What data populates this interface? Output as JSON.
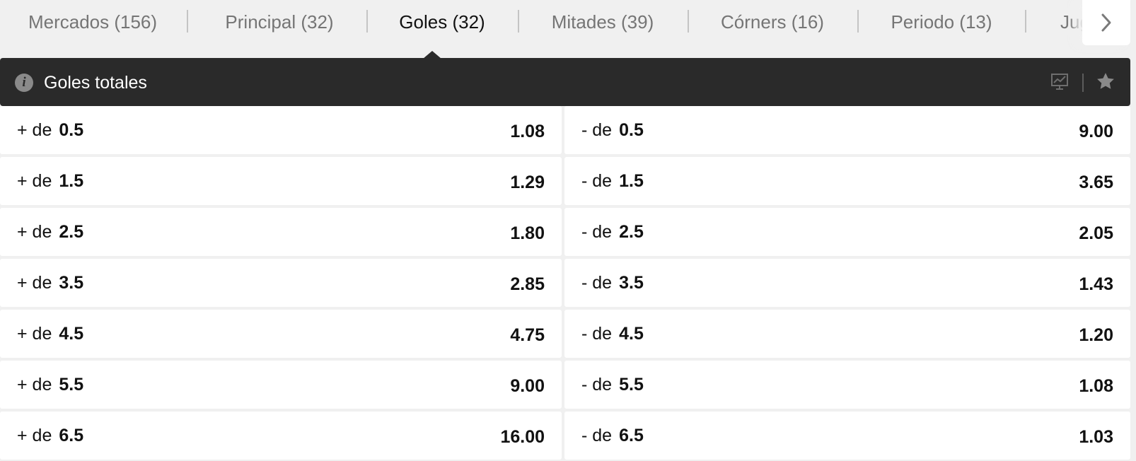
{
  "tabs": [
    {
      "label": "Mercados (156)",
      "active": false
    },
    {
      "label": "Principal (32)",
      "active": false
    },
    {
      "label": "Goles (32)",
      "active": true
    },
    {
      "label": "Mitades (39)",
      "active": false
    },
    {
      "label": "Córners (16)",
      "active": false
    },
    {
      "label": "Periodo (13)",
      "active": false
    },
    {
      "label": "Jug",
      "active": false
    }
  ],
  "tabs_next_icon": "chevron-right-icon",
  "market": {
    "title": "Goles totales",
    "info_icon": "info-icon",
    "info_glyph": "i",
    "stats_icon": "stats-chart-icon",
    "favorite_icon": "star-icon"
  },
  "rows": [
    {
      "over": {
        "prefix": "+ de",
        "line": "0.5",
        "odds": "1.08"
      },
      "under": {
        "prefix": "- de",
        "line": "0.5",
        "odds": "9.00"
      }
    },
    {
      "over": {
        "prefix": "+ de",
        "line": "1.5",
        "odds": "1.29"
      },
      "under": {
        "prefix": "- de",
        "line": "1.5",
        "odds": "3.65"
      }
    },
    {
      "over": {
        "prefix": "+ de",
        "line": "2.5",
        "odds": "1.80"
      },
      "under": {
        "prefix": "- de",
        "line": "2.5",
        "odds": "2.05"
      }
    },
    {
      "over": {
        "prefix": "+ de",
        "line": "3.5",
        "odds": "2.85"
      },
      "under": {
        "prefix": "- de",
        "line": "3.5",
        "odds": "1.43"
      }
    },
    {
      "over": {
        "prefix": "+ de",
        "line": "4.5",
        "odds": "4.75"
      },
      "under": {
        "prefix": "- de",
        "line": "4.5",
        "odds": "1.20"
      }
    },
    {
      "over": {
        "prefix": "+ de",
        "line": "5.5",
        "odds": "9.00"
      },
      "under": {
        "prefix": "- de",
        "line": "5.5",
        "odds": "1.08"
      }
    },
    {
      "over": {
        "prefix": "+ de",
        "line": "6.5",
        "odds": "16.00"
      },
      "under": {
        "prefix": "- de",
        "line": "6.5",
        "odds": "1.03"
      }
    }
  ],
  "colors": {
    "page_bg": "#f0f0f0",
    "header_bg": "#2a2a2a",
    "cell_bg": "#ffffff",
    "tab_inactive": "#757575",
    "tab_active": "#111111"
  }
}
